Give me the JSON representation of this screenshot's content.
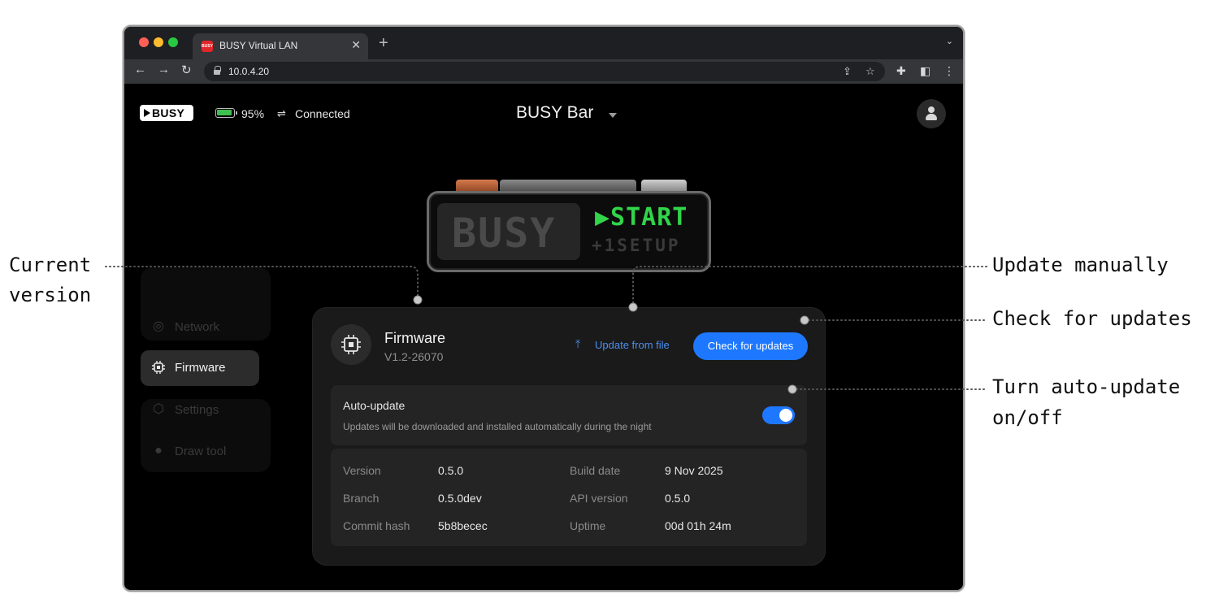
{
  "browser": {
    "tab_title": "BUSY Virtual LAN",
    "favicon_text": "BUSY",
    "url": "10.0.4.20"
  },
  "header": {
    "logo": "BUSY",
    "battery_percent": 95,
    "battery_text": "95%",
    "connection_status": "Connected",
    "device_name": "BUSY Bar"
  },
  "device_display": {
    "left_text": "BUSY",
    "right_main": "▶START",
    "right_sub": "+1SETUP"
  },
  "sidebar": {
    "items": [
      {
        "label": "Network",
        "icon": "network-icon",
        "active": false
      },
      {
        "label": "Firmware",
        "icon": "chip-icon",
        "active": true
      },
      {
        "label": "Settings",
        "icon": "settings-icon",
        "active": false
      },
      {
        "label": "Draw tool",
        "icon": "palette-icon",
        "active": false
      }
    ]
  },
  "firmware": {
    "title": "Firmware",
    "version": "V1.2-26070",
    "update_file_label": "Update from file",
    "check_button_label": "Check for updates",
    "auto_update": {
      "title": "Auto-update",
      "description": "Updates will be downloaded and installed automatically during the night",
      "enabled": true
    },
    "info": [
      {
        "label": "Version",
        "value": "0.5.0"
      },
      {
        "label": "Build date",
        "value": "9 Nov 2025"
      },
      {
        "label": "Branch",
        "value": "0.5.0dev"
      },
      {
        "label": "API version",
        "value": "0.5.0"
      },
      {
        "label": "Commit hash",
        "value": "5b8becec"
      },
      {
        "label": "Uptime",
        "value": "00d 01h 24m"
      }
    ]
  },
  "annotations": {
    "current_version_1": "Current",
    "current_version_2": "version",
    "update_manually": "Update manually",
    "check_updates": "Check for updates",
    "auto_update_1": "Turn auto-update",
    "auto_update_2": "on/off"
  },
  "colors": {
    "accent": "#1e78ff",
    "link": "#4a8ff0",
    "display_green": "#31d44a",
    "battery": "#3fbf4f"
  }
}
